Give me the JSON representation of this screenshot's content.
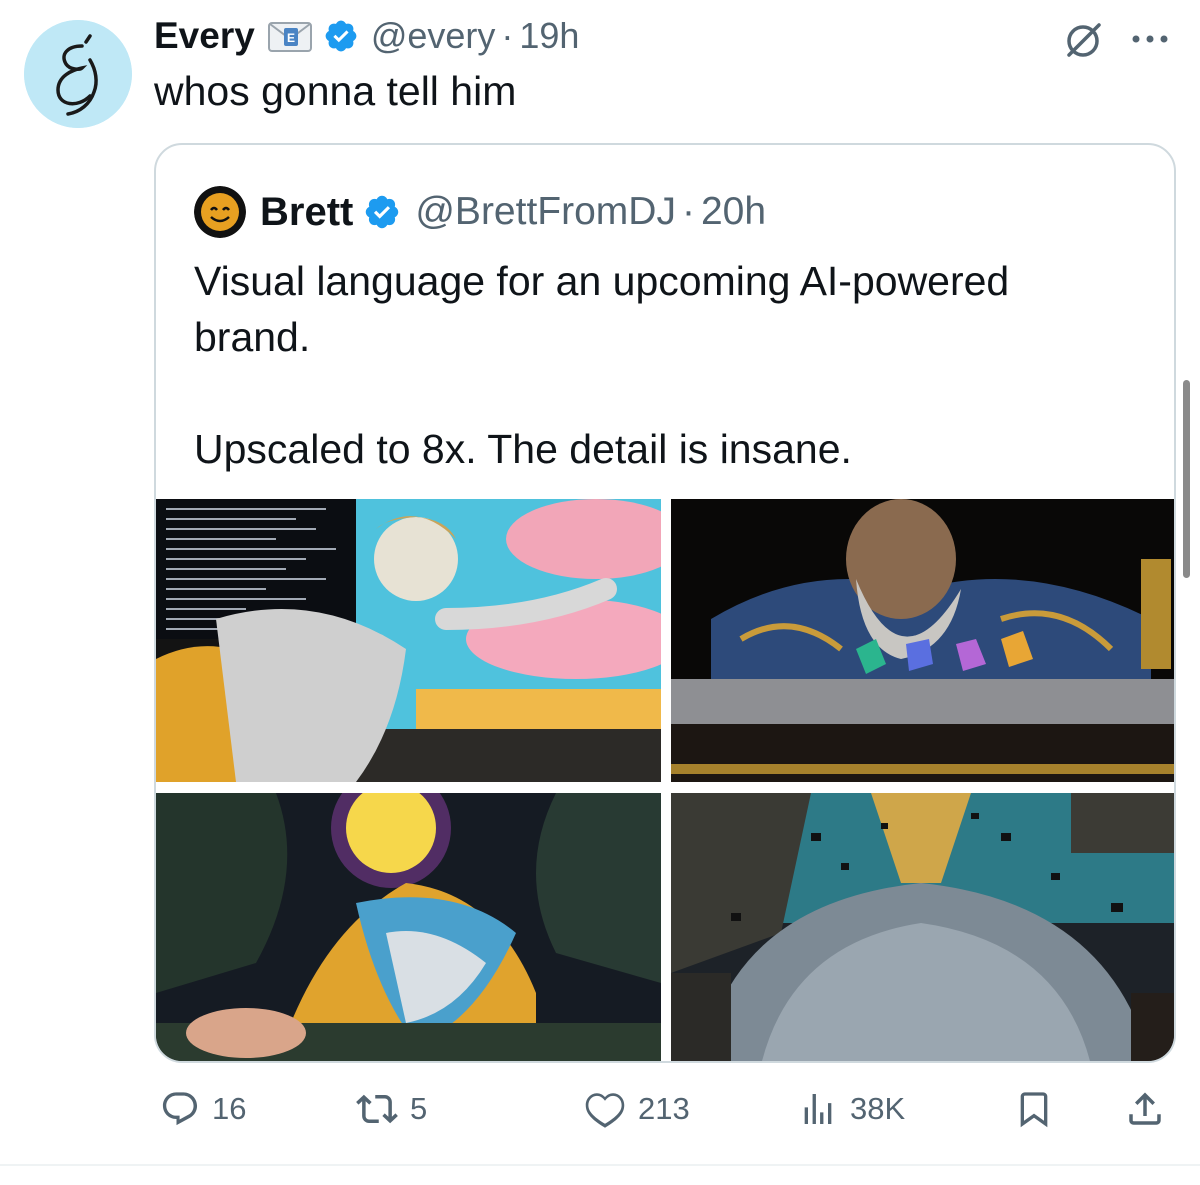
{
  "tweet": {
    "author": {
      "display_name": "Every",
      "handle": "@every",
      "badge_emoji": "e-mail-icon",
      "verified": true
    },
    "separator": "·",
    "time": "19h",
    "text": "whos gonna tell him",
    "menu": {
      "grok_icon": "grok-icon",
      "more_label": "···"
    }
  },
  "quote": {
    "author": {
      "display_name": "Brett",
      "handle": "@BrettFromDJ",
      "verified": true
    },
    "separator": "·",
    "time": "20h",
    "text_lines": [
      "Visual language for an upcoming AI-powered",
      "brand.",
      "",
      "Upscaled to 8x. The detail is insane."
    ],
    "media": [
      {
        "name": "classical-figure-with-code-image"
      },
      {
        "name": "old-man-with-dice-image"
      },
      {
        "name": "sun-headed-figure-image"
      },
      {
        "name": "dome-explosion-image"
      }
    ]
  },
  "actions": {
    "reply": {
      "icon": "reply-icon",
      "count": "16"
    },
    "retweet": {
      "icon": "retweet-icon",
      "count": "5"
    },
    "like": {
      "icon": "heart-icon",
      "count": "213"
    },
    "views": {
      "icon": "views-icon",
      "count": "38K"
    },
    "bookmark": {
      "icon": "bookmark-icon"
    },
    "share": {
      "icon": "share-icon"
    }
  },
  "colors": {
    "text": "#0f1419",
    "secondary": "#536471",
    "verified_blue": "#1d9bf0",
    "border": "#cfd9de"
  }
}
